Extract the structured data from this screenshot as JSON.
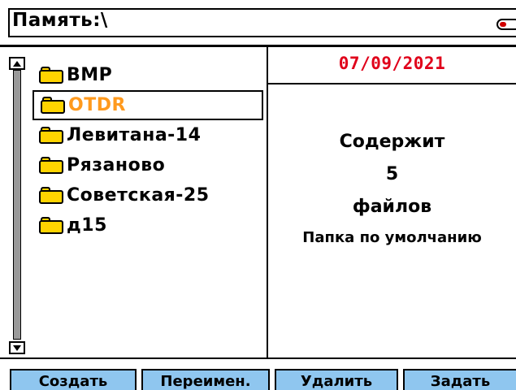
{
  "header": {
    "title": "Память:\\",
    "battery_icon": "battery-icon"
  },
  "folders": [
    {
      "label": "BMP",
      "selected": false
    },
    {
      "label": "OTDR",
      "selected": true
    },
    {
      "label": "Левитана-14",
      "selected": false
    },
    {
      "label": "Рязаново",
      "selected": false
    },
    {
      "label": "Советская-25",
      "selected": false
    },
    {
      "label": "д15",
      "selected": false
    }
  ],
  "info": {
    "date": "07/09/2021",
    "line1": "Содержит",
    "line2": "5",
    "line3": "файлов",
    "line4": "Папка по умолчанию"
  },
  "softkeys": {
    "create": "Создать",
    "rename": "Переимен.",
    "delete": "Удалить",
    "set": "Задать"
  },
  "colors": {
    "selected_text": "#ff9a1e",
    "date": "#e0001a",
    "folder": "#ffd400",
    "softkey_bg": "#8fc6ef",
    "scroll_track": "#9a9a9a"
  }
}
